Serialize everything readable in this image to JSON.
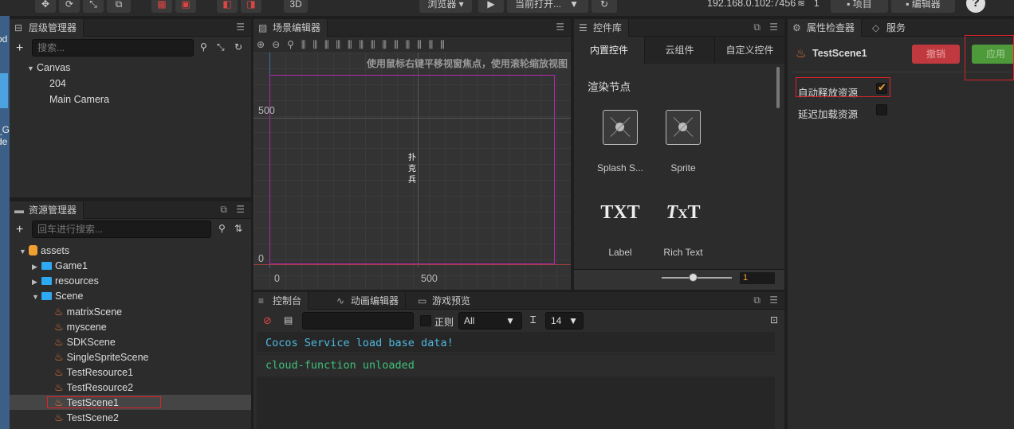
{
  "topbar": {
    "view3d": "3D",
    "browser": "浏览器",
    "scene_select": "当前打开...",
    "ip": "192.168.0.102:7456",
    "count": "1",
    "project": "项目",
    "editor": "编辑器",
    "help": "?"
  },
  "hierarchy": {
    "title": "层级管理器",
    "search_placeholder": "搜索...",
    "nodes": [
      "Canvas",
      "204",
      "Main Camera"
    ]
  },
  "assets": {
    "title": "资源管理器",
    "search_placeholder": "回车进行搜索...",
    "root": "assets",
    "folders": [
      "Game1",
      "resources",
      "Scene"
    ],
    "scenes": [
      "matrixScene",
      "myscene",
      "SDKScene",
      "SingleSpriteScene",
      "TestResource1",
      "TestResource2",
      "TestScene1",
      "TestScene2"
    ]
  },
  "scene_editor": {
    "title": "场景编辑器",
    "hint": "使用鼠标右键平移视窗焦点，使用滚轮缩放视图",
    "y_labels": [
      "500",
      "0"
    ],
    "x_labels": [
      "0",
      "500"
    ],
    "node_text": [
      "扑",
      "克",
      "兵"
    ]
  },
  "control_library": {
    "title": "控件库",
    "tabs": [
      "内置控件",
      "云组件",
      "自定义控件"
    ],
    "section": "渲染节点",
    "items": [
      "Splash S...",
      "Sprite",
      "Label",
      "Rich Text"
    ],
    "zoom_value": "1"
  },
  "console": {
    "tabs": [
      "控制台",
      "动画编辑器",
      "游戏预览"
    ],
    "regex_label": "正则",
    "level": "All",
    "font_size": "14",
    "lines": [
      {
        "text": "Cocos Service load base data!",
        "color": "#4fb8e0"
      },
      {
        "text": "cloud-function unloaded",
        "color": "#3fc07a"
      }
    ]
  },
  "inspector": {
    "tabs": [
      "属性检查器",
      "服务"
    ],
    "asset_name": "TestScene1",
    "revert": "撤销",
    "apply": "应用",
    "props": [
      {
        "label": "自动释放资源",
        "checked": true
      },
      {
        "label": "延迟加载资源",
        "checked": false
      }
    ]
  },
  "left_edge": {
    "texts": [
      "od",
      "_G",
      "de"
    ]
  },
  "colors": {
    "accent_orange": "#f0a030",
    "revert_red": "#c0393f",
    "apply_green": "#4e9a3a",
    "highlight_red": "#e0222a"
  }
}
